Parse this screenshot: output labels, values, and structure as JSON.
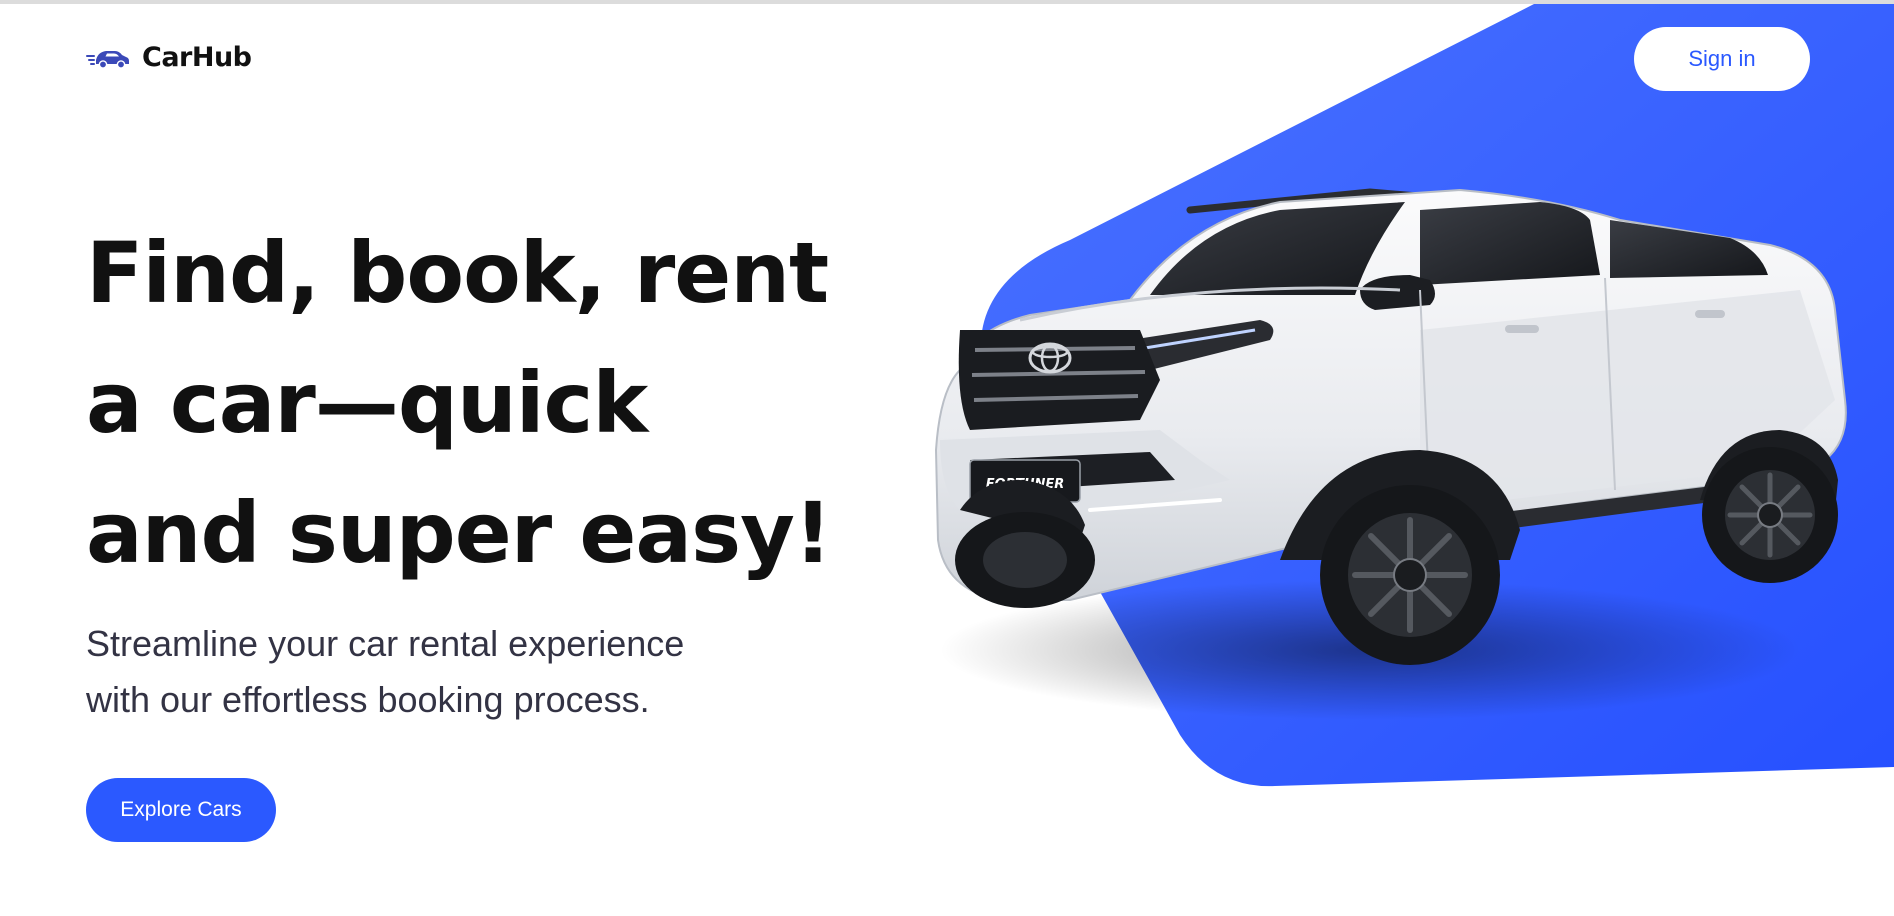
{
  "navbar": {
    "brand_name": "CarHub",
    "brand_icon": "speeding-car-icon",
    "signin_label": "Sign in"
  },
  "hero": {
    "title_lines": [
      "Find, book, rent",
      "a car—quick",
      "and super easy!"
    ],
    "subtitle_lines": [
      "Streamline your car rental experience",
      "with our effortless booking process."
    ],
    "cta_label": "Explore Cars",
    "image_plate_text": "FORTUNER",
    "image_emblem": "toyota-logo"
  },
  "colors": {
    "accent": "#2b59ff",
    "background": "#ffffff",
    "heading": "#111111",
    "body_text": "#333344",
    "car_body": "#e9ebef"
  }
}
